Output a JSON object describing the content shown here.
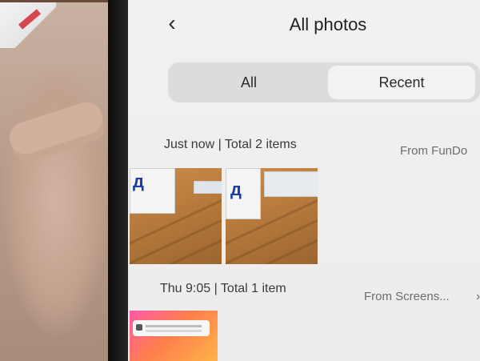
{
  "header": {
    "back_icon": "chevron-left-icon",
    "title": "All photos"
  },
  "tabs": [
    {
      "label": "All",
      "selected": false
    },
    {
      "label": "Recent",
      "selected": true
    }
  ],
  "groups": [
    {
      "header": "Just now | Total 2 items",
      "source": "From FunDo",
      "item_count": 2
    },
    {
      "header": "Thu 9:05 | Total 1 item",
      "source": "From Screens...",
      "item_count": 1
    }
  ],
  "colors": {
    "screen_bg": "#efefef",
    "segment_track": "#dcdcdc",
    "segment_selected": "#f3f3f3",
    "thumbnail_pink": "#ff5aa7"
  }
}
